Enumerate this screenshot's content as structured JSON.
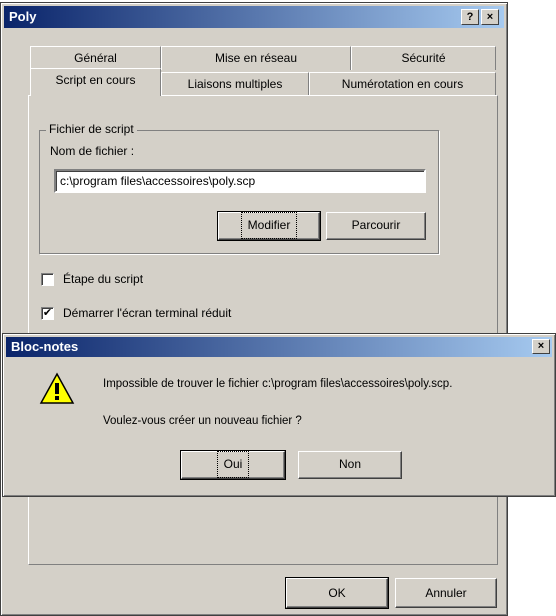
{
  "main_window": {
    "title": "Poly",
    "help_btn": "?",
    "close_btn": "×",
    "tabs_row1": [
      "Général",
      "Mise en réseau",
      "Sécurité"
    ],
    "tabs_row2": [
      "Script en cours",
      "Liaisons multiples",
      "Numérotation en cours"
    ],
    "group_title": "Fichier de script",
    "filename_label": "Nom de fichier :",
    "filename_value": "c:\\program files\\accessoires\\poly.scp",
    "modify_btn": "Modifier",
    "browse_btn": "Parcourir",
    "checkbox_step_label": "Étape du script",
    "checkbox_step_checked": false,
    "checkbox_terminal_label": "Démarrer l'écran terminal réduit",
    "checkbox_terminal_checked": true,
    "ok_btn": "OK",
    "cancel_btn": "Annuler",
    "check_mark": "✔"
  },
  "notepad_dialog": {
    "title": "Bloc-notes",
    "close_btn": "×",
    "message_line1": "Impossible de trouver le fichier c:\\program files\\accessoires\\poly.scp.",
    "message_line2": "Voulez-vous créer un nouveau fichier ?",
    "yes_btn": "Oui",
    "no_btn": "Non",
    "icon": "warning-icon"
  },
  "colors": {
    "face": "#d4d0c8",
    "title_start": "#0a246a",
    "title_end": "#a6caf0",
    "warning_yellow": "#ffff00"
  }
}
